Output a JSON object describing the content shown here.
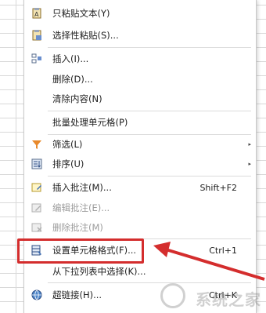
{
  "menu": {
    "items": [
      {
        "label": "只粘贴文本(Y)",
        "shortcut": "",
        "icon": "paste-text-icon",
        "disabled": false
      },
      {
        "label": "选择性粘贴(S)...",
        "shortcut": "",
        "icon": "paste-special-icon",
        "disabled": false
      },
      {
        "label": "插入(I)...",
        "shortcut": "",
        "icon": "insert-icon",
        "disabled": false
      },
      {
        "label": "删除(D)...",
        "shortcut": "",
        "icon": "",
        "disabled": false
      },
      {
        "label": "清除内容(N)",
        "shortcut": "",
        "icon": "",
        "disabled": false
      },
      {
        "label": "批量处理单元格(P)",
        "shortcut": "",
        "icon": "",
        "disabled": false
      },
      {
        "label": "筛选(L)",
        "shortcut": "",
        "icon": "filter-icon",
        "disabled": false,
        "submenu": true
      },
      {
        "label": "排序(U)",
        "shortcut": "",
        "icon": "sort-icon",
        "disabled": false,
        "submenu": true
      },
      {
        "label": "插入批注(M)...",
        "shortcut": "Shift+F2",
        "icon": "insert-comment-icon",
        "disabled": false
      },
      {
        "label": "编辑批注(E)...",
        "shortcut": "",
        "icon": "edit-comment-icon",
        "disabled": true
      },
      {
        "label": "删除批注(M)",
        "shortcut": "",
        "icon": "delete-comment-icon",
        "disabled": true
      },
      {
        "label": "设置单元格格式(F)...",
        "shortcut": "Ctrl+1",
        "icon": "format-cells-icon",
        "disabled": false
      },
      {
        "label": "从下拉列表中选择(K)...",
        "shortcut": "",
        "icon": "",
        "disabled": false
      },
      {
        "label": "超链接(H)...",
        "shortcut": "Ctrl+K",
        "icon": "hyperlink-icon",
        "disabled": false
      }
    ],
    "submenu_arrow": "▸"
  },
  "icons": {
    "paste-text-icon": "📋",
    "paste-special-icon": "📋",
    "insert-icon": "⊞",
    "filter-icon": "▼",
    "sort-icon": "⇅",
    "insert-comment-icon": "✎",
    "edit-comment-icon": "✎",
    "delete-comment-icon": "✕",
    "format-cells-icon": "▣",
    "hyperlink-icon": "🌐"
  },
  "annotation": {
    "highlight_color": "#d42d2d",
    "arrow_color": "#d42d2d"
  },
  "watermark": {
    "text": "系统之家"
  }
}
